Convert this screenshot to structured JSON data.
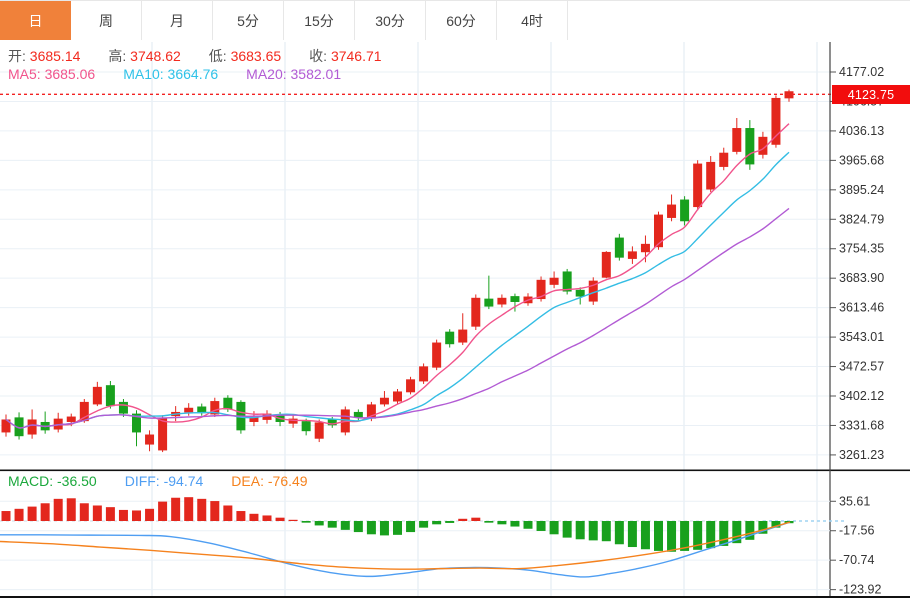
{
  "tabs": {
    "items": [
      {
        "label": "日",
        "active": true
      },
      {
        "label": "周",
        "active": false
      },
      {
        "label": "月",
        "active": false
      },
      {
        "label": "5分",
        "active": false
      },
      {
        "label": "15分",
        "active": false
      },
      {
        "label": "30分",
        "active": false
      },
      {
        "label": "60分",
        "active": false
      },
      {
        "label": "4时",
        "active": false
      }
    ]
  },
  "readout": {
    "ohlc": [
      {
        "label": "开:",
        "value": "3685.14"
      },
      {
        "label": "高:",
        "value": "3748.62"
      },
      {
        "label": "低:",
        "value": "3683.65"
      },
      {
        "label": "收:",
        "value": "3746.71"
      }
    ],
    "ma": [
      {
        "label": "MA5:",
        "value": "3685.06",
        "color": "#f1548c"
      },
      {
        "label": "MA10:",
        "value": "3664.76",
        "color": "#2fc2e8"
      },
      {
        "label": "MA20:",
        "value": "3582.01",
        "color": "#b25bd4"
      }
    ],
    "macd": [
      {
        "label": "MACD:",
        "value": "-36.50",
        "color": "#1ba83c"
      },
      {
        "label": "DIFF:",
        "value": "-94.74",
        "color": "#4f9ef2"
      },
      {
        "label": "DEA:",
        "value": "-76.49",
        "color": "#f5821e"
      }
    ]
  },
  "price_axis": {
    "labels": [
      "4177.02",
      "4106.57",
      "4036.13",
      "3965.68",
      "3895.24",
      "3824.79",
      "3754.35",
      "3683.90",
      "3613.46",
      "3543.01",
      "3472.57",
      "3402.12",
      "3331.68",
      "3261.23"
    ],
    "current": {
      "value": "4123.75"
    }
  },
  "macd_axis": {
    "labels": [
      "35.61",
      "-17.56",
      "-70.74",
      "-123.92"
    ]
  },
  "colors": {
    "bull": "#e3271d",
    "bear": "#18a01d",
    "ma5": "#f1548c",
    "ma10": "#34bde4",
    "ma20": "#b25bd4",
    "diff": "#4f9ef2",
    "dea": "#f5821e",
    "accent": "#f0813a",
    "price_box": "#f20d0d",
    "value_red": "#f22a1e",
    "grid_v": "#dfe9f2",
    "grid_h": "#eaf0f6",
    "axis_line": "#444",
    "zero_dash": "#9fd4f2",
    "current_line": "#f32222"
  },
  "chart_data": {
    "type": "candlestick+macd",
    "main": {
      "title": "",
      "y_ticks": [
        4177.02,
        4106.57,
        4036.13,
        3965.68,
        3895.24,
        3824.79,
        3754.35,
        3683.9,
        3613.46,
        3543.01,
        3472.57,
        3402.12,
        3331.68,
        3261.23
      ],
      "ylim": [
        3230,
        4200
      ],
      "current_price": 4123.75,
      "ma_periods": [
        5,
        10,
        20
      ],
      "ohlc": [
        [
          3315,
          3358,
          3305,
          3346
        ],
        [
          3351,
          3363,
          3298,
          3306
        ],
        [
          3310,
          3370,
          3300,
          3346
        ],
        [
          3340,
          3365,
          3312,
          3320
        ],
        [
          3322,
          3362,
          3315,
          3348
        ],
        [
          3340,
          3360,
          3330,
          3353
        ],
        [
          3342,
          3395,
          3338,
          3388
        ],
        [
          3382,
          3436,
          3378,
          3424
        ],
        [
          3428,
          3438,
          3372,
          3378
        ],
        [
          3388,
          3395,
          3352,
          3360
        ],
        [
          3360,
          3368,
          3282,
          3315
        ],
        [
          3286,
          3320,
          3270,
          3310
        ],
        [
          3272,
          3356,
          3268,
          3350
        ],
        [
          3354,
          3378,
          3342,
          3364
        ],
        [
          3363,
          3385,
          3355,
          3374
        ],
        [
          3377,
          3384,
          3355,
          3361
        ],
        [
          3358,
          3398,
          3352,
          3390
        ],
        [
          3398,
          3404,
          3364,
          3370
        ],
        [
          3388,
          3392,
          3312,
          3320
        ],
        [
          3340,
          3366,
          3330,
          3352
        ],
        [
          3345,
          3368,
          3336,
          3360
        ],
        [
          3358,
          3364,
          3330,
          3340
        ],
        [
          3336,
          3356,
          3326,
          3348
        ],
        [
          3342,
          3348,
          3308,
          3318
        ],
        [
          3300,
          3346,
          3292,
          3339
        ],
        [
          3346,
          3352,
          3326,
          3332
        ],
        [
          3315,
          3377,
          3308,
          3370
        ],
        [
          3364,
          3370,
          3344,
          3350
        ],
        [
          3348,
          3388,
          3342,
          3382
        ],
        [
          3382,
          3414,
          3377,
          3398
        ],
        [
          3389,
          3419,
          3384,
          3413
        ],
        [
          3411,
          3448,
          3406,
          3442
        ],
        [
          3437,
          3480,
          3431,
          3473
        ],
        [
          3470,
          3537,
          3464,
          3530
        ],
        [
          3556,
          3562,
          3518,
          3526
        ],
        [
          3530,
          3600,
          3524,
          3561
        ],
        [
          3568,
          3645,
          3560,
          3637
        ],
        [
          3635,
          3690,
          3610,
          3616
        ],
        [
          3621,
          3645,
          3614,
          3637
        ],
        [
          3641,
          3647,
          3604,
          3627
        ],
        [
          3624,
          3648,
          3618,
          3640
        ],
        [
          3634,
          3688,
          3628,
          3680
        ],
        [
          3668,
          3700,
          3660,
          3685
        ],
        [
          3700,
          3706,
          3645,
          3652
        ],
        [
          3656,
          3662,
          3621,
          3640
        ],
        [
          3628,
          3686,
          3620,
          3678
        ],
        [
          3685.14,
          3748.62,
          3683.65,
          3746.71
        ],
        [
          3781,
          3790,
          3726,
          3733
        ],
        [
          3730,
          3760,
          3718,
          3748
        ],
        [
          3746,
          3786,
          3722,
          3766
        ],
        [
          3758,
          3843,
          3752,
          3836
        ],
        [
          3828,
          3884,
          3820,
          3860
        ],
        [
          3872,
          3880,
          3810,
          3820
        ],
        [
          3854,
          3966,
          3846,
          3958
        ],
        [
          3896,
          3976,
          3890,
          3962
        ],
        [
          3950,
          3996,
          3942,
          3984
        ],
        [
          3986,
          4067,
          3980,
          4043
        ],
        [
          4043,
          4062,
          3943,
          3956
        ],
        [
          3979,
          4034,
          3970,
          4022
        ],
        [
          4003,
          4121,
          3996,
          4115
        ],
        [
          4114,
          4135,
          4106,
          4131
        ]
      ]
    },
    "macd": {
      "y_ticks": [
        35.61,
        -17.56,
        -70.74,
        -123.92
      ],
      "readout": {
        "macd": -36.5,
        "diff": -94.74,
        "dea": -76.49
      },
      "histogram": [
        18,
        22,
        26,
        32,
        40,
        41,
        32,
        28,
        25,
        20,
        19,
        22,
        35,
        42,
        43,
        40,
        36,
        28,
        18,
        13,
        10,
        6,
        2,
        -3,
        -8,
        -12,
        -16,
        -20,
        -24,
        -26,
        -25,
        -20,
        -12,
        -6,
        -3.5,
        4,
        6,
        -3,
        -6,
        -10,
        -14,
        -18,
        -24,
        -30,
        -33,
        -35,
        -36.5,
        -42,
        -47,
        -51,
        -54,
        -55.5,
        -54,
        -52,
        -49,
        -45,
        -40,
        -34,
        -23,
        -12,
        -4
      ],
      "diff_points": [
        [
          0,
          -25
        ],
        [
          40,
          -25
        ],
        [
          90,
          -25.5
        ],
        [
          140,
          -26
        ],
        [
          170,
          -28
        ],
        [
          210,
          -40
        ],
        [
          250,
          -58
        ],
        [
          290,
          -78
        ],
        [
          330,
          -93
        ],
        [
          370,
          -100
        ],
        [
          410,
          -93
        ],
        [
          440,
          -86
        ],
        [
          470,
          -84
        ],
        [
          500,
          -85
        ],
        [
          530,
          -89
        ],
        [
          560,
          -97
        ],
        [
          585,
          -101
        ],
        [
          610,
          -95
        ],
        [
          640,
          -85
        ],
        [
          670,
          -72
        ],
        [
          700,
          -55
        ],
        [
          730,
          -38
        ],
        [
          760,
          -20
        ],
        [
          790,
          -2
        ]
      ],
      "dea_points": [
        [
          0,
          -37
        ],
        [
          50,
          -41
        ],
        [
          100,
          -47
        ],
        [
          150,
          -53
        ],
        [
          200,
          -60
        ],
        [
          250,
          -67
        ],
        [
          300,
          -77
        ],
        [
          350,
          -84
        ],
        [
          400,
          -87
        ],
        [
          440,
          -86
        ],
        [
          480,
          -85
        ],
        [
          520,
          -86
        ],
        [
          560,
          -80
        ],
        [
          600,
          -72
        ],
        [
          640,
          -62
        ],
        [
          680,
          -50
        ],
        [
          720,
          -35
        ],
        [
          755,
          -20
        ],
        [
          790,
          -2
        ]
      ]
    }
  }
}
